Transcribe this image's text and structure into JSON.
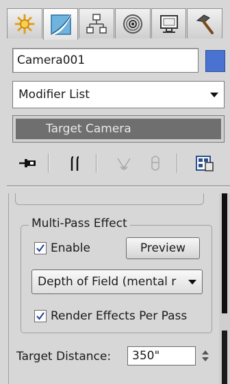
{
  "tabs": [
    {
      "icon": "create-icon"
    },
    {
      "icon": "modify-icon",
      "active": true
    },
    {
      "icon": "hierarchy-icon"
    },
    {
      "icon": "motion-icon"
    },
    {
      "icon": "display-icon"
    },
    {
      "icon": "utilities-icon"
    }
  ],
  "object": {
    "name": "Camera001",
    "color": "#4a72d1"
  },
  "modifier_list": {
    "label": "Modifier List"
  },
  "stack": {
    "items": [
      "Target Camera"
    ]
  },
  "toolbar": {
    "icons": [
      "pin-stack-icon",
      "show-end-result-icon",
      "make-unique-icon",
      "remove-modifier-icon",
      "configure-modifier-sets-icon"
    ]
  },
  "multipass": {
    "title": "Multi-Pass Effect",
    "enable_label": "Enable",
    "enable_checked": true,
    "preview_label": "Preview",
    "effect_selected": "Depth of Field (mental r",
    "render_effects_label": "Render Effects Per Pass",
    "render_effects_checked": true
  },
  "target_distance": {
    "label": "Target Distance:",
    "value": "350\""
  }
}
